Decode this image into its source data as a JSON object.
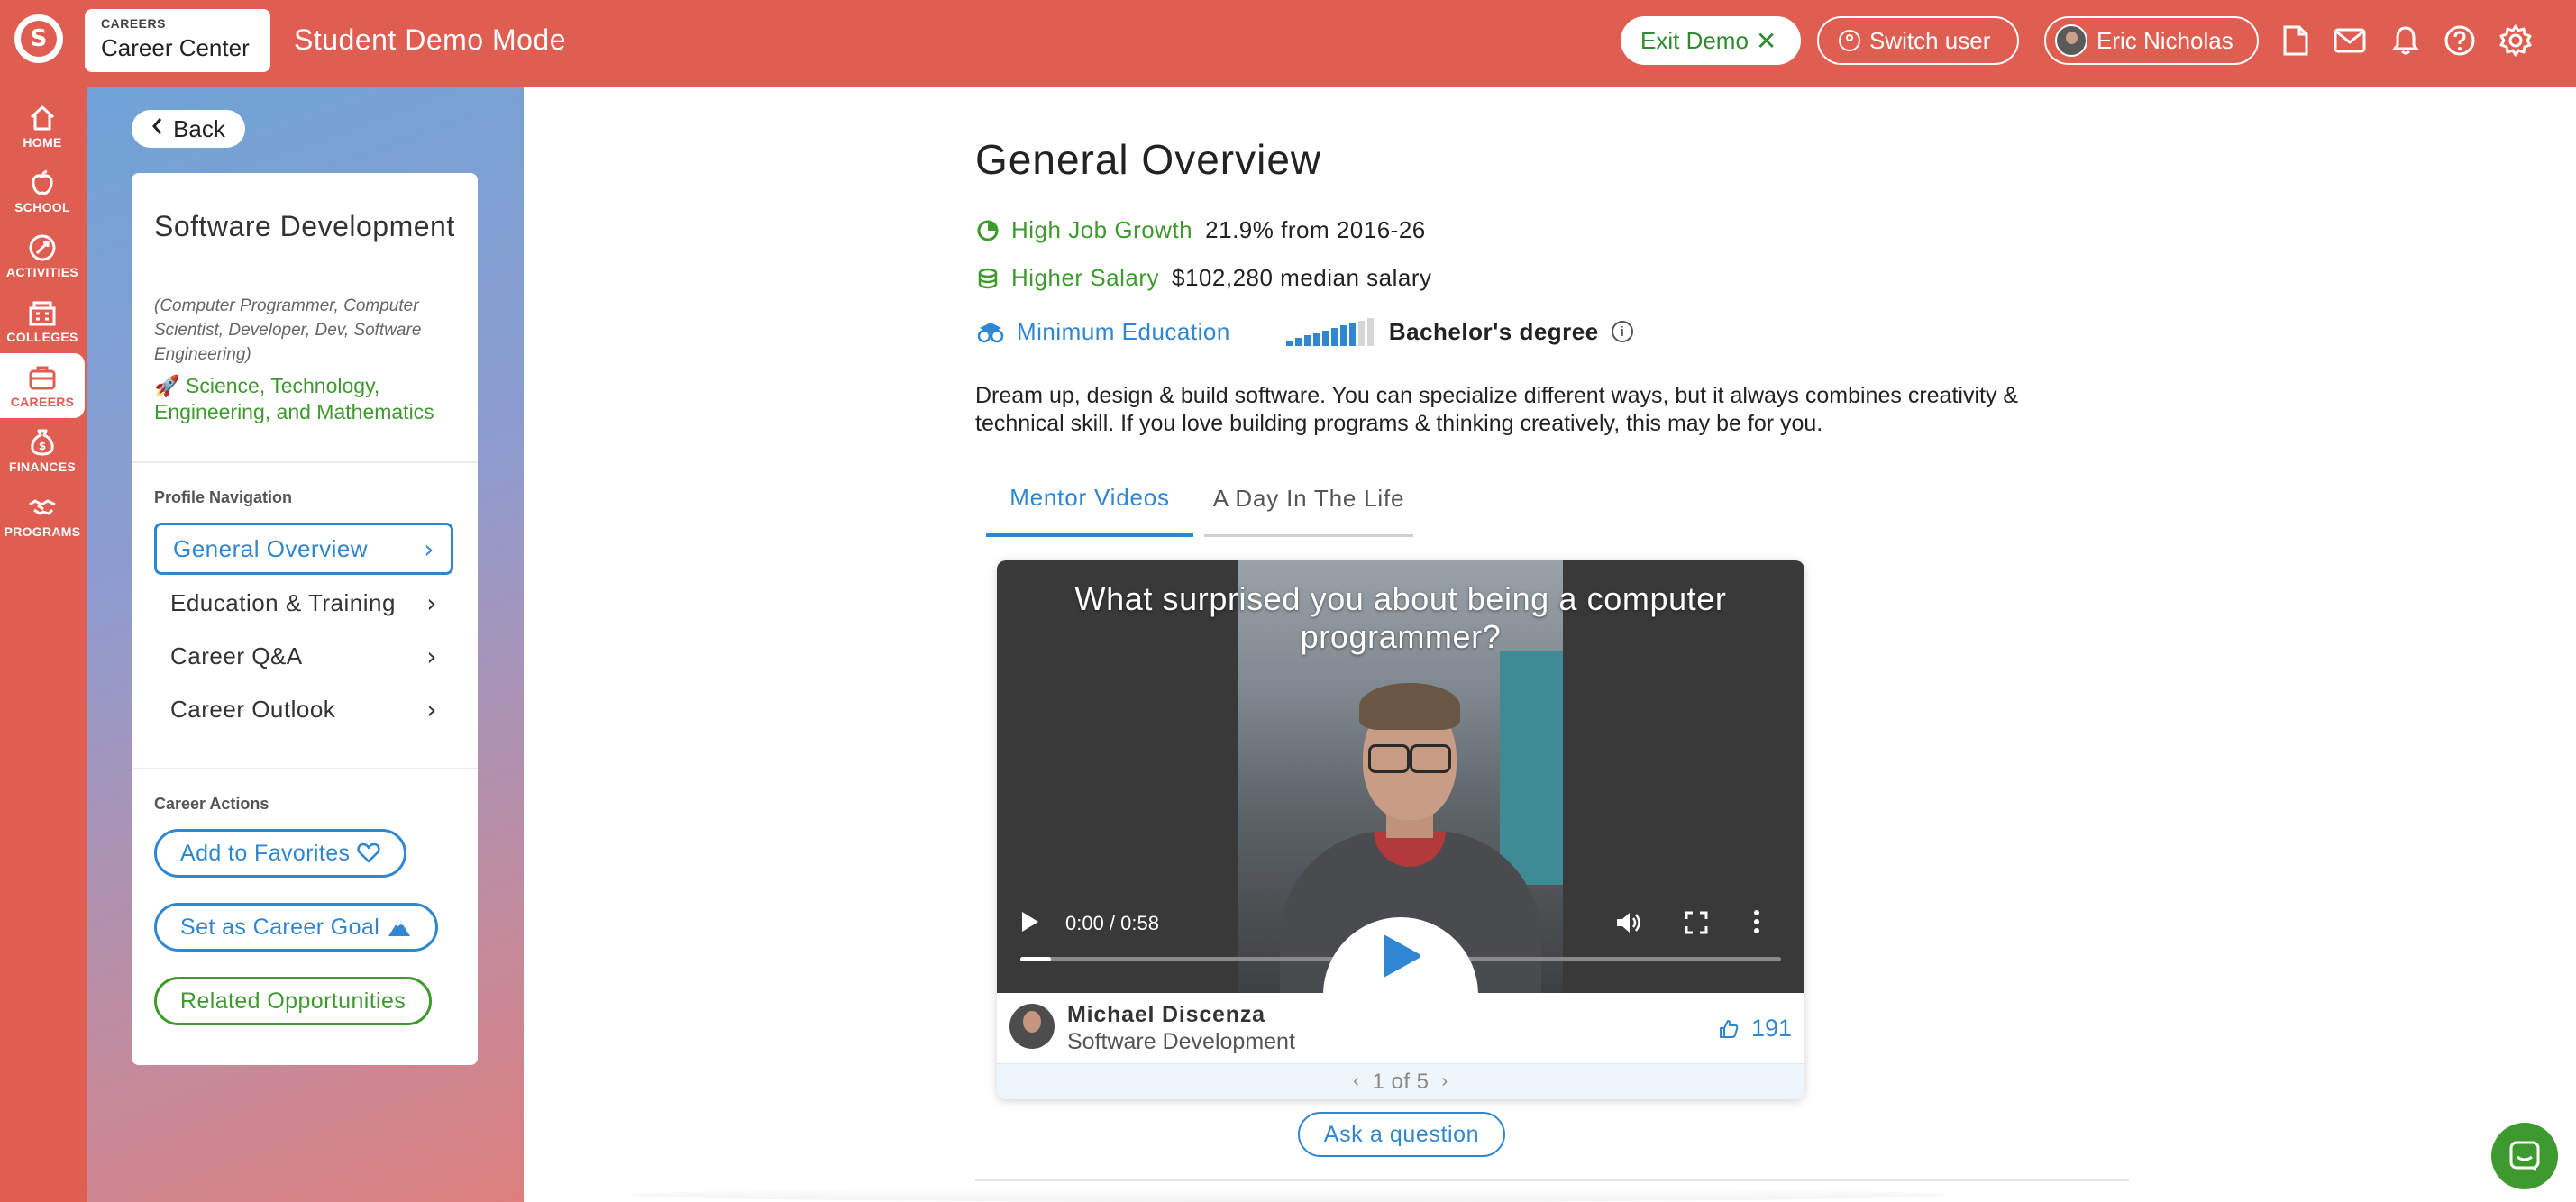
{
  "header": {
    "logo_glyph": "S",
    "section_small": "CAREERS",
    "section_title": "Career Center",
    "mode_title": "Student Demo Mode",
    "exit_demo_label": "Exit Demo",
    "exit_glyph": "✕",
    "switch_user_label": "Switch user",
    "user_name": "Eric Nicholas",
    "icons": [
      "document-icon",
      "mail-icon",
      "bell-icon",
      "help-icon",
      "gear-icon"
    ]
  },
  "rail": {
    "items": [
      {
        "label": "HOME",
        "icon": "home-icon"
      },
      {
        "label": "SCHOOL",
        "icon": "apple-icon"
      },
      {
        "label": "ACTIVITIES",
        "icon": "activities-icon"
      },
      {
        "label": "COLLEGES",
        "icon": "college-icon"
      },
      {
        "label": "CAREERS",
        "icon": "briefcase-icon",
        "active": true
      },
      {
        "label": "FINANCES",
        "icon": "moneybag-icon"
      },
      {
        "label": "PROGRAMS",
        "icon": "handshake-icon"
      }
    ]
  },
  "sidebar": {
    "back_label": "Back",
    "career_title": "Software Development",
    "alt_titles": "(Computer Programmer, Computer Scientist, Developer, Dev, Software Engineering)",
    "cluster": "🚀 Science, Technology, Engineering, and Mathematics",
    "profile_nav_heading": "Profile Navigation",
    "nav_items": [
      {
        "label": "General Overview",
        "active": true
      },
      {
        "label": "Education & Training"
      },
      {
        "label": "Career Q&A"
      },
      {
        "label": "Career Outlook"
      }
    ],
    "nav_chevron": "›",
    "actions_heading": "Career Actions",
    "add_favorites_label": "Add to Favorites",
    "set_goal_label": "Set as Career Goal",
    "related_label": "Related Opportunities"
  },
  "main": {
    "title": "General Overview",
    "job_growth_label": "High Job Growth",
    "job_growth_value": "21.9% from 2016-26",
    "salary_label": "Higher Salary",
    "salary_value": "$102,280 median salary",
    "education_label": "Minimum Education",
    "education_value": "Bachelor's degree",
    "education_level_fraction": 0.8,
    "info_glyph": "i",
    "description": "Dream up, design & build software. You can specialize different ways, but it always combines creativity & technical skill. If you love building programs & thinking creatively, this may be for you.",
    "tabs": [
      {
        "label": "Mentor Videos",
        "active": true
      },
      {
        "label": "A Day In The Life"
      }
    ],
    "video": {
      "question": "What surprised you about being a computer programmer?",
      "time": "0:00 / 0:58",
      "progress_fraction": 0.04
    },
    "mentor": {
      "name": "Michael Discenza",
      "career": "Software Development",
      "likes": "191"
    },
    "pager": {
      "prev": "‹",
      "text": "1 of 5",
      "next": "›"
    },
    "ask_label": "Ask a question"
  },
  "colors": {
    "brand_red": "#e05d52",
    "link_blue": "#2f86d1",
    "success_green": "#3e9a2e"
  }
}
